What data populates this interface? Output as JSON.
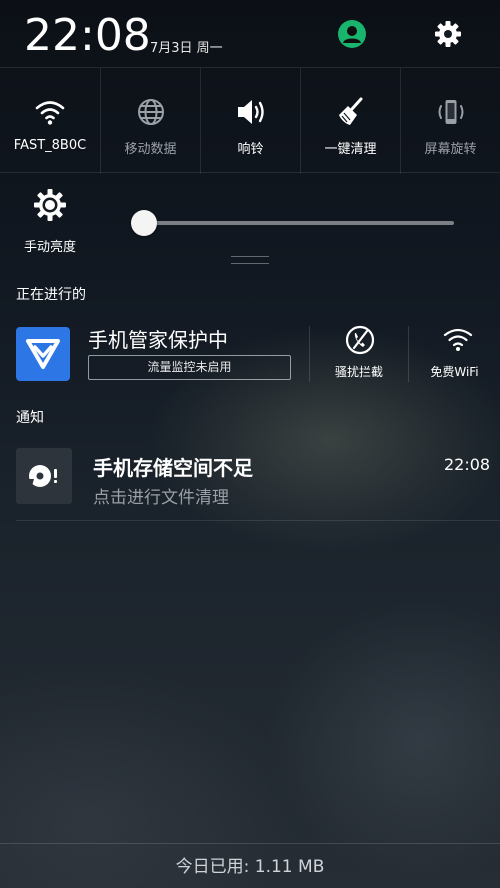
{
  "header": {
    "time": "22:08",
    "date": "7月3日 周一",
    "avatar_icon": "user-avatar-icon",
    "settings_icon": "gear-icon"
  },
  "toggles": [
    {
      "label": "FAST_8B0C",
      "icon": "wifi-icon",
      "active": true
    },
    {
      "label": "移动数据",
      "icon": "globe-icon",
      "active": false
    },
    {
      "label": "响铃",
      "icon": "speaker-icon",
      "active": true
    },
    {
      "label": "一键清理",
      "icon": "broom-icon",
      "active": true
    },
    {
      "label": "屏幕旋转",
      "icon": "rotate-phone-icon",
      "active": false
    }
  ],
  "brightness": {
    "label": "手动亮度",
    "level": 0
  },
  "ongoing": {
    "title": "正在进行的",
    "app_title": "手机管家保护中",
    "status": "流量监控未启用",
    "actions": [
      {
        "label": "骚扰拦截",
        "icon": "block-call-icon"
      },
      {
        "label": "免费WiFi",
        "icon": "wifi-icon"
      }
    ]
  },
  "notifications": {
    "title": "通知",
    "items": [
      {
        "title": "手机存储空间不足",
        "subtitle": "点击进行文件清理",
        "time": "22:08",
        "icon": "storage-warning-icon"
      }
    ]
  },
  "footer": {
    "text": "今日已用: 1.11 MB"
  },
  "colors": {
    "accent_green": "#19b56e",
    "app_blue": "#2d76e6",
    "inactive_text": "#9aa0a6"
  }
}
